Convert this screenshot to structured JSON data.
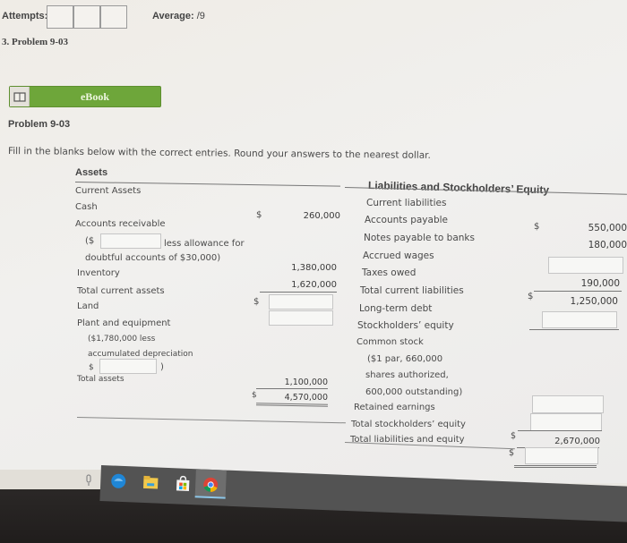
{
  "header": {
    "attempts_label": "Attempts:",
    "average_label": "Average:",
    "average_value": "/9",
    "problem_link": "3. Problem 9-03"
  },
  "ebook": {
    "label": "eBook",
    "icon": "book-icon"
  },
  "problem": {
    "title": "Problem 9-03",
    "instructions": "Fill in the blanks below with the correct entries. Round your answers to the nearest dollar."
  },
  "assets": {
    "heading": "Assets",
    "current_assets_label": "Current Assets",
    "cash_label": "Cash",
    "cash_currency": "$",
    "cash_value": "260,000",
    "ar_label": "Accounts receivable",
    "ar_prefix": "($",
    "ar_input_value": "",
    "ar_suffix": "less allowance for",
    "ar_line2": "doubtful accounts of $30,000)",
    "ar_value_input": "",
    "inventory_label": "Inventory",
    "inventory_value": "1,380,000",
    "total_current_label": "Total current assets",
    "total_current_value": "1,620,000",
    "land_label": "Land",
    "land_currency": "$",
    "land_input_value": "",
    "plant_label": "Plant and equipment",
    "plant_line2": "($1,780,000 less",
    "plant_line3": "accumulated depreciation",
    "plant_dep_prefix": "$",
    "plant_dep_input_value": "",
    "plant_dep_suffix": ")",
    "plant_input_value": "",
    "plant_value": "1,100,000",
    "total_assets_label": "Total assets",
    "total_assets_currency": "$",
    "total_assets_value": "4,570,000"
  },
  "liabilities": {
    "heading": "Liabilities and Stockholders’ Equity",
    "current_label": "Current liabilities",
    "ap_label": "Accounts payable",
    "ap_currency": "$",
    "ap_value": "550,000",
    "notes_label": "Notes payable to banks",
    "notes_value": "180,000",
    "wages_label": "Accrued wages",
    "wages_input_value": "",
    "taxes_label": "Taxes owed",
    "taxes_value": "190,000",
    "total_current_label": "Total current liabilities",
    "total_current_currency": "$",
    "total_current_value": "1,250,000",
    "ltd_label": "Long-term debt",
    "ltd_input_value": "",
    "se_label": "Stockholders’ equity",
    "cs_label": "Common stock",
    "cs_line2": "($1 par, 660,000",
    "cs_line3": "shares authorized,",
    "cs_line4": "600,000 outstanding)",
    "cs_input_value": "",
    "re_label": "Retained earnings",
    "re_input_value": "",
    "total_se_label": "Total stockholders’ equity",
    "total_se_currency": "$",
    "total_se_value": "2,670,000",
    "total_le_label": "Total liabilities and equity",
    "total_le_currency": "$",
    "total_le_input_value": ""
  },
  "taskbar": {
    "items": [
      {
        "name": "microphone-icon"
      },
      {
        "name": "edge-browser-icon"
      },
      {
        "name": "file-explorer-icon"
      },
      {
        "name": "store-icon"
      },
      {
        "name": "chrome-icon",
        "active": true
      }
    ]
  }
}
